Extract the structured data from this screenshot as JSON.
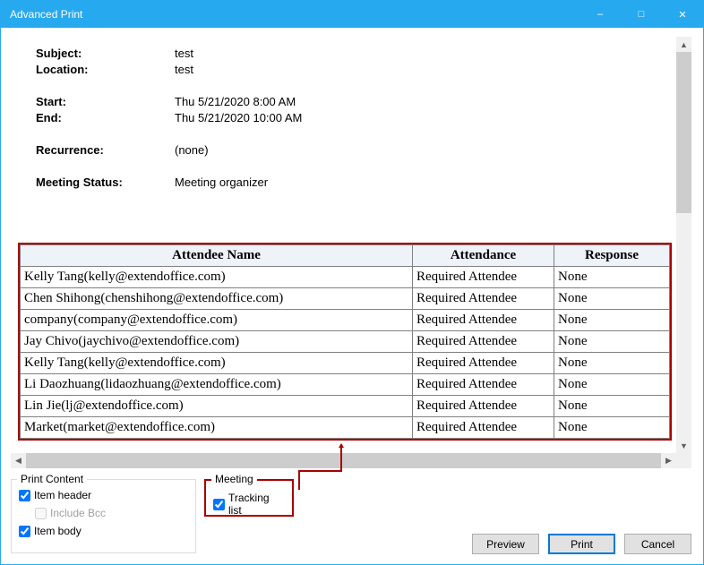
{
  "window": {
    "title": "Advanced Print"
  },
  "meta": {
    "subject_label": "Subject:",
    "subject_value": "test",
    "location_label": "Location:",
    "location_value": "test",
    "start_label": "Start:",
    "start_value": "Thu 5/21/2020 8:00 AM",
    "end_label": "End:",
    "end_value": "Thu 5/21/2020 10:00 AM",
    "recurrence_label": "Recurrence:",
    "recurrence_value": "(none)",
    "status_label": "Meeting Status:",
    "status_value": "Meeting organizer"
  },
  "table": {
    "headers": {
      "name": "Attendee Name",
      "attendance": "Attendance",
      "response": "Response"
    },
    "rows": [
      {
        "name": "Kelly Tang(kelly@extendoffice.com)",
        "attendance": "Required Attendee",
        "response": "None"
      },
      {
        "name": "Chen Shihong(chenshihong@extendoffice.com)",
        "attendance": "Required Attendee",
        "response": "None"
      },
      {
        "name": "company(company@extendoffice.com)",
        "attendance": "Required Attendee",
        "response": "None"
      },
      {
        "name": "Jay Chivo(jaychivo@extendoffice.com)",
        "attendance": "Required Attendee",
        "response": "None"
      },
      {
        "name": "Kelly Tang(kelly@extendoffice.com)",
        "attendance": "Required Attendee",
        "response": "None"
      },
      {
        "name": "Li Daozhuang(lidaozhuang@extendoffice.com)",
        "attendance": "Required Attendee",
        "response": "None"
      },
      {
        "name": "Lin Jie(lj@extendoffice.com)",
        "attendance": "Required Attendee",
        "response": "None"
      },
      {
        "name": "Market(market@extendoffice.com)",
        "attendance": "Required Attendee",
        "response": "None"
      }
    ]
  },
  "groups": {
    "print_content": {
      "legend": "Print Content",
      "item_header": "Item header",
      "include_bcc": "Include Bcc",
      "item_body": "Item body"
    },
    "meeting": {
      "legend": "Meeting",
      "tracking_list": "Tracking list"
    }
  },
  "buttons": {
    "preview": "Preview",
    "print": "Print",
    "cancel": "Cancel"
  }
}
